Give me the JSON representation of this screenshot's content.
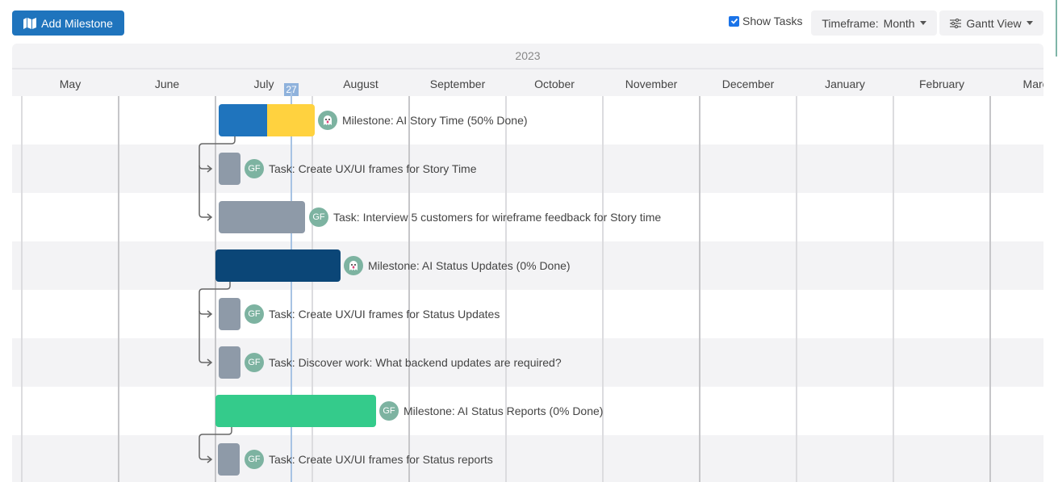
{
  "toolbar": {
    "add_milestone_label": "Add Milestone",
    "add_milestone_icon": "map-icon",
    "show_tasks_label": "Show Tasks",
    "show_tasks_checked": true,
    "timeframe_label": "Timeframe:",
    "timeframe_value": "Month",
    "view_icon": "sliders-icon",
    "view_label": "Gantt View"
  },
  "timeline": {
    "year": "2023",
    "months": [
      "May",
      "June",
      "July",
      "August",
      "September",
      "October",
      "November",
      "December",
      "January",
      "February",
      "March"
    ],
    "today_marker": "27"
  },
  "rows": [
    {
      "type": "milestone",
      "label": "Milestone: AI Story Time (50% Done)",
      "avatar": "ghost-icon",
      "progress": 0.5,
      "colors": {
        "done": "#1f74bd",
        "todo": "#ffd23f"
      }
    },
    {
      "type": "task",
      "label": "Task: Create UX/UI frames for Story Time",
      "avatar": "GF"
    },
    {
      "type": "task",
      "label": "Task: Interview 5 customers for wireframe feedback for Story time",
      "avatar": "GF"
    },
    {
      "type": "milestone",
      "label": "Milestone: AI Status Updates (0% Done)",
      "avatar": "ghost-icon",
      "progress": 0,
      "colors": {
        "bar": "#0b4677"
      }
    },
    {
      "type": "task",
      "label": "Task: Create UX/UI frames for Status Updates",
      "avatar": "GF"
    },
    {
      "type": "task",
      "label": "Task: Discover work: What backend updates are required?",
      "avatar": "GF"
    },
    {
      "type": "milestone",
      "label": "Milestone: AI Status Reports (0% Done)",
      "avatar": "GF",
      "progress": 0,
      "colors": {
        "bar": "#34cb8b"
      }
    },
    {
      "type": "task",
      "label": "Task: Create UX/UI frames for Status reports",
      "avatar": "GF"
    }
  ]
}
